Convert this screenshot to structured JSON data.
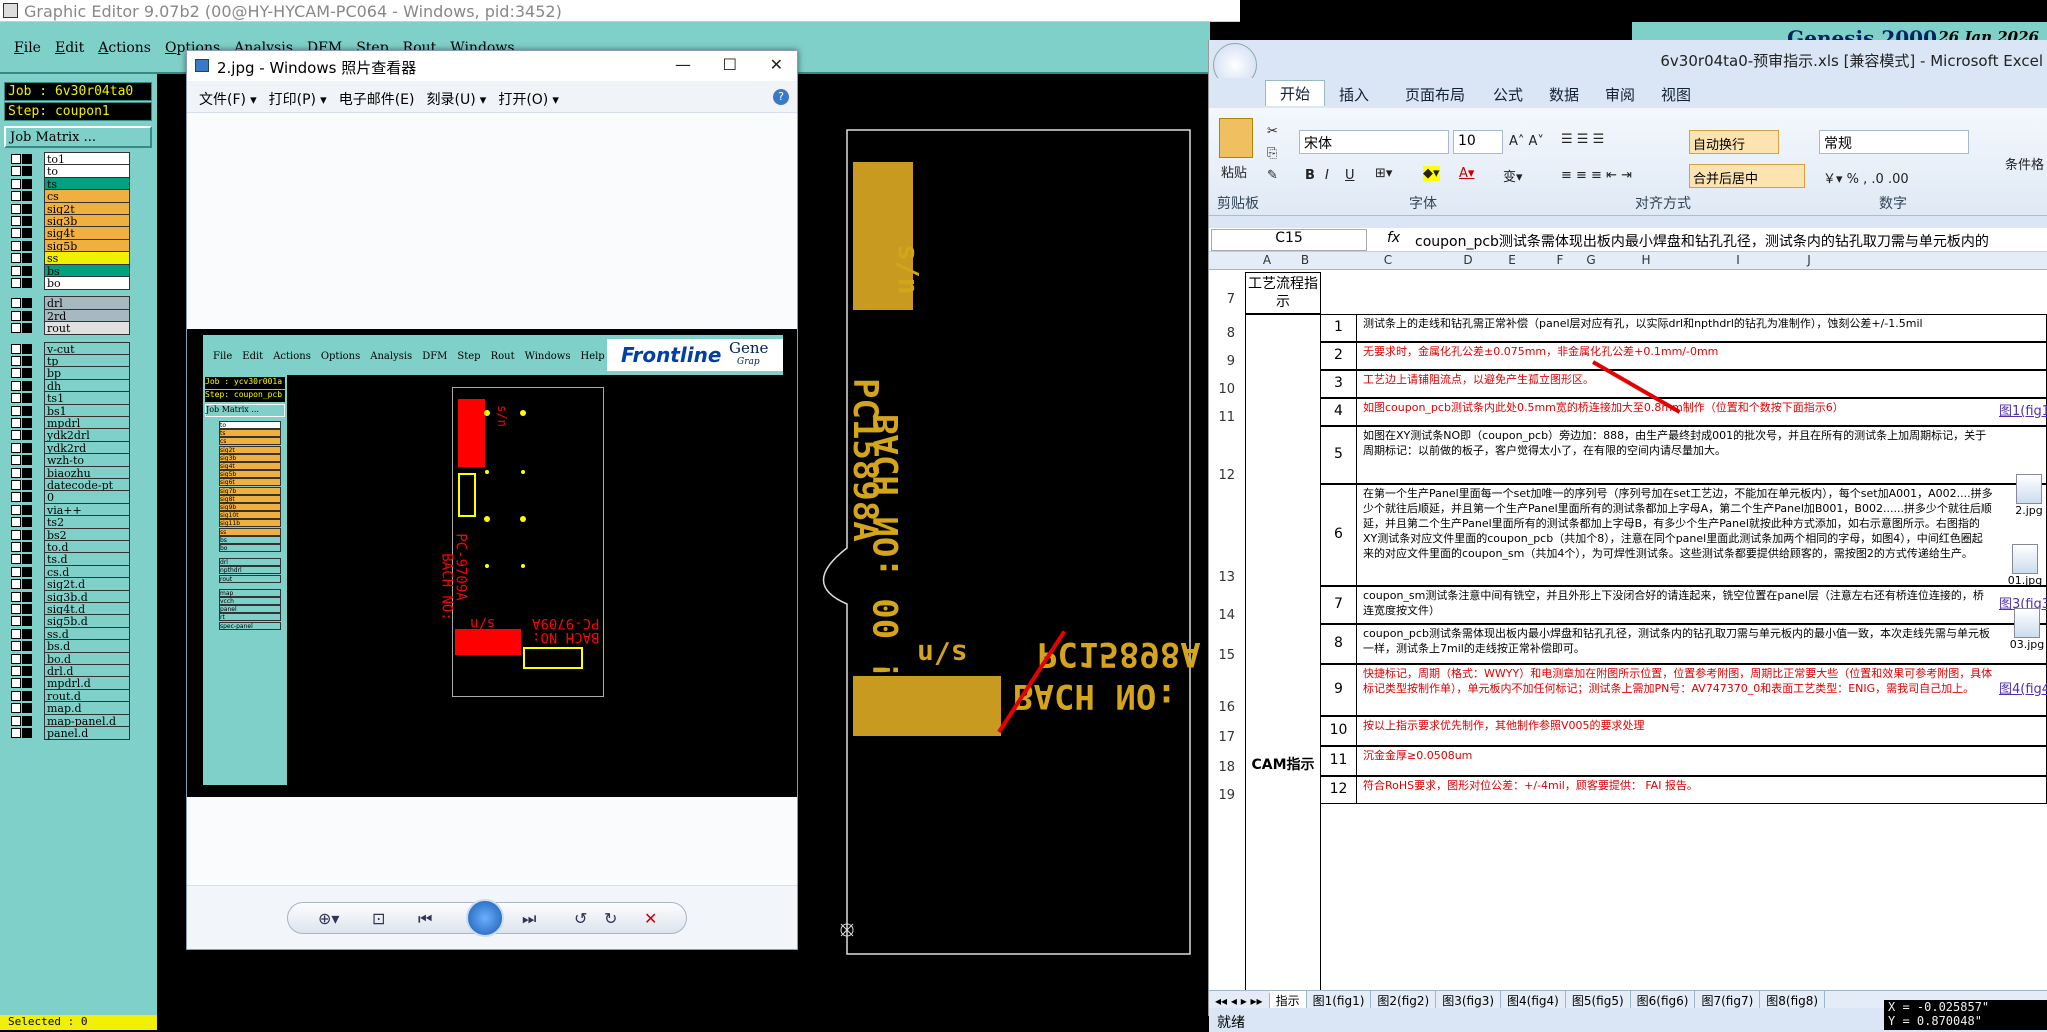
{
  "ge": {
    "title": "Graphic Editor 9.07b2 (00@HY-HYCAM-PC064 - Windows, pid:3452)",
    "menu": [
      "File",
      "Edit",
      "Actions",
      "Options",
      "Analysis",
      "DFM",
      "Step",
      "Rout",
      "Windows"
    ],
    "job": "Job : 6v30r04ta0",
    "step": "Step: coupon1",
    "job_matrix": "Job Matrix ...",
    "brand": "Genesis 2000",
    "date": "26 Jan 2026",
    "selected": "Selected : 0",
    "coord_x": "X = -0.025857\"",
    "coord_y": "Y = 0.870048\"",
    "layers": [
      {
        "n": "to1",
        "c": "#ffffff"
      },
      {
        "n": "to",
        "c": "#ffffff"
      },
      {
        "n": "ts",
        "c": "#00a080"
      },
      {
        "n": "cs",
        "c": "#f0b040"
      },
      {
        "n": "sig2t",
        "c": "#f0b040"
      },
      {
        "n": "sig3b",
        "c": "#f0b040"
      },
      {
        "n": "sig4t",
        "c": "#f0b040"
      },
      {
        "n": "sig5b",
        "c": "#f0b040"
      },
      {
        "n": "ss",
        "c": "#f0f000"
      },
      {
        "n": "bs",
        "c": "#00a080"
      },
      {
        "n": "bo",
        "c": "#ffffff"
      },
      {
        "n": "drl",
        "c": "#a8b8c0"
      },
      {
        "n": "2rd",
        "c": "#a8b8c0"
      },
      {
        "n": "rout",
        "c": "#e0e0e0"
      },
      {
        "n": "v-cut",
        "c": "#7fd0c8"
      },
      {
        "n": "tp",
        "c": "#7fd0c8"
      },
      {
        "n": "bp",
        "c": "#7fd0c8"
      },
      {
        "n": "dh",
        "c": "#7fd0c8"
      },
      {
        "n": "ts1",
        "c": "#7fd0c8"
      },
      {
        "n": "bs1",
        "c": "#7fd0c8"
      },
      {
        "n": "mpdrl",
        "c": "#7fd0c8"
      },
      {
        "n": "ydk2drl",
        "c": "#7fd0c8"
      },
      {
        "n": "ydk2rd",
        "c": "#7fd0c8"
      },
      {
        "n": "wzh-to",
        "c": "#7fd0c8"
      },
      {
        "n": "biaozhu",
        "c": "#7fd0c8"
      },
      {
        "n": "datecode-pt",
        "c": "#7fd0c8"
      },
      {
        "n": "0",
        "c": "#7fd0c8"
      },
      {
        "n": "via++",
        "c": "#7fd0c8"
      },
      {
        "n": "ts2",
        "c": "#7fd0c8"
      },
      {
        "n": "bs2",
        "c": "#7fd0c8"
      },
      {
        "n": "to.d",
        "c": "#7fd0c8"
      },
      {
        "n": "ts.d",
        "c": "#7fd0c8"
      },
      {
        "n": "cs.d",
        "c": "#7fd0c8"
      },
      {
        "n": "sig2t.d",
        "c": "#7fd0c8"
      },
      {
        "n": "sig3b.d",
        "c": "#7fd0c8"
      },
      {
        "n": "sig4t.d",
        "c": "#7fd0c8"
      },
      {
        "n": "sig5b.d",
        "c": "#7fd0c8"
      },
      {
        "n": "ss.d",
        "c": "#7fd0c8"
      },
      {
        "n": "bs.d",
        "c": "#7fd0c8"
      },
      {
        "n": "bo.d",
        "c": "#7fd0c8"
      },
      {
        "n": "drl.d",
        "c": "#7fd0c8"
      },
      {
        "n": "mpdrl.d",
        "c": "#7fd0c8"
      },
      {
        "n": "rout.d",
        "c": "#7fd0c8"
      },
      {
        "n": "map.d",
        "c": "#7fd0c8"
      },
      {
        "n": "map-panel.d",
        "c": "#7fd0c8"
      },
      {
        "n": "panel.d",
        "c": "#7fd0c8"
      }
    ],
    "pcb": {
      "text1": "PC15898A",
      "text2": "BACH NO:",
      "text3": "s/n",
      "vtext1": "PC15898A",
      "vtext2": "BACH NO: 00 !",
      "vtext3": "s/n"
    }
  },
  "viewer": {
    "title": "2.jpg - Windows 照片查看器",
    "menu": [
      "文件(F)",
      "打印(P)",
      "电子邮件(E)",
      "刻录(U)",
      "打开(O)"
    ],
    "inner": {
      "menu": [
        "File",
        "Edit",
        "Actions",
        "Options",
        "Analysis",
        "DFM",
        "Step",
        "Rout",
        "Windows",
        "Help"
      ],
      "brand": "Frontline",
      "brand2": "Gene",
      "brand3": "Grap",
      "job": "Job : ycv30r001a",
      "step": "Step: coupon_pcb",
      "matrix": "Job Matrix ...",
      "layers": [
        "to",
        "ts",
        "cs",
        "sig2t",
        "sig3b",
        "sig4t",
        "sig5b",
        "sig6t",
        "sig7b",
        "sig8t",
        "sig9b",
        "sig10t",
        "sig11b",
        "ss",
        "bs",
        "bo",
        "drl",
        "npthdrl",
        "rout",
        "map",
        "vcch",
        "panel",
        "rt",
        "spec-panel"
      ],
      "t1": "PC-9709A",
      "t2": "BACH NO:",
      "t3": "s/n",
      "t4": "PC-9709A",
      "t5": "BACH NO:",
      "t6": "s/n"
    }
  },
  "excel": {
    "title": "6v30r04ta0-预审指示.xls [兼容模式] - Microsoft Excel",
    "tabs": [
      "开始",
      "插入",
      "页面布局",
      "公式",
      "数据",
      "审阅",
      "视图"
    ],
    "font": "宋体",
    "size": "10",
    "numfmt": "常规",
    "wrap": "自动换行",
    "merge": "合并后居中",
    "paste": "粘贴",
    "cond": "条件格",
    "groups": [
      "剪贴板",
      "字体",
      "对齐方式",
      "数字"
    ],
    "namebox": "C15",
    "fx": "fx",
    "formula": "coupon_pcb测试条需体现出板内最小焊盘和钻孔孔径，测试条内的钻孔取刀需与单元板内的",
    "cols": [
      "A",
      "B",
      "C",
      "D",
      "E",
      "F",
      "G",
      "H",
      "I",
      "J"
    ],
    "sec1": "工艺流程指示",
    "sec2": "CAM指示",
    "rows": [
      {
        "r": "8",
        "n": "1",
        "t": "测试条上的走线和钻孔需正常补偿（panel层对应有孔，以实际drl和npthdrl的钻孔为准制作），蚀刻公差+/-1.5mil",
        "red": false,
        "j": ""
      },
      {
        "r": "9",
        "n": "2",
        "t": "无要求时，金属化孔公差±0.075mm，非金属化孔公差+0.1mm/-0mm",
        "red": true,
        "j": ""
      },
      {
        "r": "10",
        "n": "3",
        "t": "工艺边上请铺阻流点，以避免产生孤立图形区。",
        "red": true,
        "j": ""
      },
      {
        "r": "11",
        "n": "4",
        "t": "如图coupon_pcb测试条内此处0.5mm宽的桥连接加大至0.8mm制作（位置和个数按下面指示6）",
        "red": true,
        "j": "图1(fig1)"
      },
      {
        "r": "12",
        "n": "5",
        "t": "如图在XY测试条NO即（coupon_pcb）旁边加：888，由生产最终封成001的批次号，并且在所有的测试条上加周期标记，关于周期标记：以前做的板子，客户觉得太小了，在有限的空间内请尽量加大。",
        "red": false,
        "j": ""
      },
      {
        "r": "13",
        "n": "6",
        "t": "在第一个生产Panel里面每一个set加唯一的序列号（序列号加在set工艺边，不能加在单元板内），每个set加A001，A002....拼多少个就往后顺延，并且第一个生产Panel里面所有的测试条都加上字母A，第二个生产Panel加B001，B002......拼多少个就往后顺延，并且第二个生产Panel里面所有的测试条都加上字母B，有多少个生产Panel就按此种方式添加，如右示意图所示。右图指的XY测试条对应文件里面的coupon_pcb（共加个8），注意在同个panel里面此测试条加两个相同的字母，如图4），中间红色圈起来的对应文件里面的coupon_sm（共加4个），为可焊性测试条。这些测试条都要提供给顾客的，需按图2的方式传递给生产。",
        "red": false,
        "j": ""
      },
      {
        "r": "14",
        "n": "7",
        "t": "coupon_sm测试条注意中间有铣空，并且外形上下没闭合好的请连起来，铣空位置在panel层（注意左右还有桥连位连接的，桥连宽度按文件）",
        "red": false,
        "j": "图3(fig3)"
      },
      {
        "r": "15",
        "n": "8",
        "t": "coupon_pcb测试条需体现出板内最小焊盘和钻孔孔径，测试条内的钻孔取刀需与单元板内的最小值一致，本次走线先需与单元板一样，测试条上7mil的走线按正常补偿即可。",
        "red": false,
        "j": ""
      },
      {
        "r": "16",
        "n": "9",
        "t": "快捷标记，周期（格式：WWYY）和电测章加在附图所示位置，位置参考附图，周期比正常要大些（位置和效果可参考附图，具体标记类型按制作单），单元板内不加任何标记；测试条上需加PN号：AV747370_0和表面工艺类型：ENIG，需我司自己加上。",
        "red": true,
        "j": "图4(fig4)"
      },
      {
        "r": "17",
        "n": "10",
        "t": "按以上指示要求优先制作，其他制作参照V005的要求处理",
        "red": true,
        "j": ""
      },
      {
        "r": "18",
        "n": "11",
        "t": "沉金金厚≥0.0508um",
        "red": true,
        "j": ""
      },
      {
        "r": "19",
        "n": "12",
        "t": "符合RoHS要求，图形对位公差：+/-4mil，顾客要提供： FAI 报告。",
        "red": true,
        "j": ""
      }
    ],
    "rnum7": "7",
    "files": [
      "2.jpg",
      "01.jpg",
      "03.jpg"
    ],
    "sheets": [
      "指示",
      "图1(fig1)",
      "图2(fig2)",
      "图3(fig3)",
      "图4(fig4)",
      "图5(fig5)",
      "图6(fig6)",
      "图7(fig7)",
      "图8(fig8)"
    ],
    "status": "就绪"
  }
}
